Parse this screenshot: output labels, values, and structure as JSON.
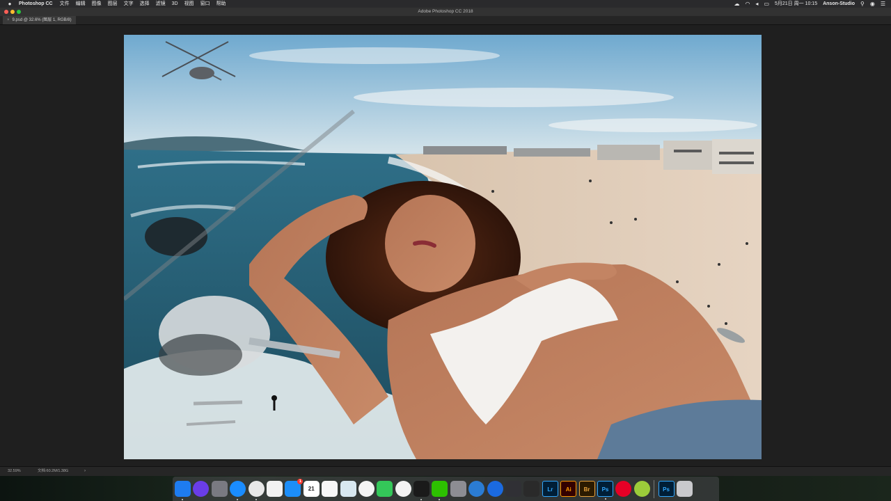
{
  "menubar": {
    "app_name": "Photoshop CC",
    "menus": [
      "文件",
      "编辑",
      "图像",
      "图层",
      "文字",
      "选择",
      "滤镜",
      "3D",
      "视图",
      "窗口",
      "帮助"
    ],
    "status_icons": [
      "creative-cloud-icon",
      "wifi-icon",
      "sound-icon",
      "battery-icon",
      "keyboard-icon"
    ],
    "datetime": "5月21日 周一 10:15",
    "user": "Anson-Studio"
  },
  "window": {
    "title": "Adobe Photoshop CC 2018"
  },
  "document": {
    "tab_label": "9.psd @ 32.6% (图层 1, RGB/8)",
    "close_symbol": "×"
  },
  "statusbar": {
    "zoom": "32.59%",
    "doc_info": "文档:60.2M/1.38G",
    "arrow": "›"
  },
  "dock": {
    "apps": [
      {
        "name": "finder",
        "label": "",
        "color": "#1e7cf0"
      },
      {
        "name": "siri",
        "label": "",
        "color": "#6a3de8"
      },
      {
        "name": "launchpad",
        "label": "",
        "color": "#7a7a82"
      },
      {
        "name": "safari",
        "label": "",
        "color": "#1a8cff"
      },
      {
        "name": "chrome",
        "label": "",
        "color": "#e8e8e8"
      },
      {
        "name": "textedit",
        "label": "",
        "color": "#f2f2f2"
      },
      {
        "name": "app-store",
        "label": "",
        "color": "#1c8ef9"
      },
      {
        "name": "calendar",
        "label": "21",
        "color": "#ffffff"
      },
      {
        "name": "reminders",
        "label": "",
        "color": "#f7f7f7"
      },
      {
        "name": "preview",
        "label": "",
        "color": "#d8e8f0"
      },
      {
        "name": "photos",
        "label": "",
        "color": "#f4f4f4"
      },
      {
        "name": "facetime",
        "label": "",
        "color": "#34c759"
      },
      {
        "name": "itunes",
        "label": "",
        "color": "#f3f3f3"
      },
      {
        "name": "qq",
        "label": "",
        "color": "#1a1a1a"
      },
      {
        "name": "wechat",
        "label": "",
        "color": "#2dc100"
      },
      {
        "name": "system-preferences",
        "label": "",
        "color": "#8d8d93"
      },
      {
        "name": "edge",
        "label": "",
        "color": "#2b7cd3"
      },
      {
        "name": "1password",
        "label": "",
        "color": "#1b6ae0"
      },
      {
        "name": "paw",
        "label": "",
        "color": "#303035"
      },
      {
        "name": "final-cut",
        "label": "",
        "color": "#2a2a2a"
      },
      {
        "name": "lightroom",
        "label": "Lr",
        "color": "#001e36"
      },
      {
        "name": "illustrator",
        "label": "Ai",
        "color": "#330000"
      },
      {
        "name": "bridge",
        "label": "Br",
        "color": "#2b1a00"
      },
      {
        "name": "photoshop",
        "label": "Ps",
        "color": "#001e36"
      },
      {
        "name": "netease-music",
        "label": "",
        "color": "#e60026"
      },
      {
        "name": "pitchfork",
        "label": "",
        "color": "#9ccc3a"
      },
      {
        "name": "photoshop-file",
        "label": "Ps",
        "color": "#001e36"
      },
      {
        "name": "trash",
        "label": "",
        "color": "#c9c9cc"
      }
    ],
    "calendar_badge": "1"
  }
}
